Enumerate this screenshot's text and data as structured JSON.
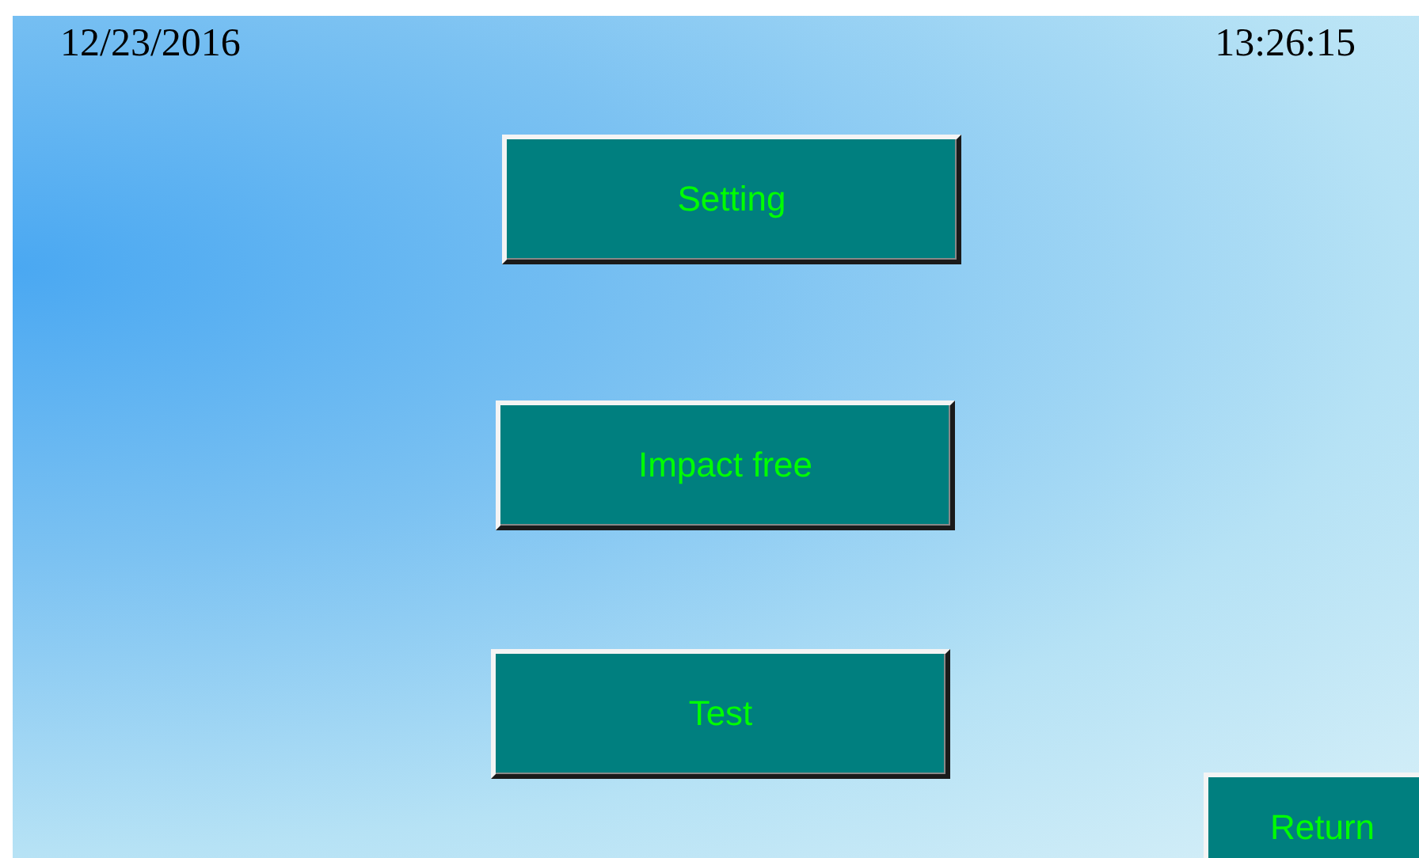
{
  "date": "12/23/2016",
  "time": "13:26:15",
  "menu_buttons": [
    {
      "label": "Setting"
    },
    {
      "label": "Impact free"
    },
    {
      "label": "Test"
    }
  ],
  "return_button": {
    "label": "Return"
  }
}
